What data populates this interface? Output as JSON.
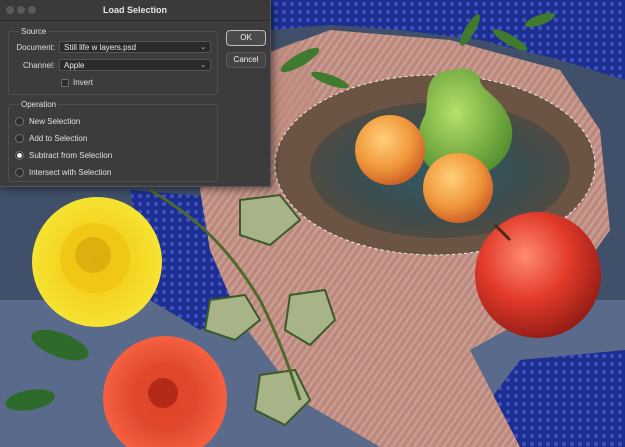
{
  "dialog": {
    "title": "Load Selection",
    "source": {
      "legend": "Source",
      "document_label": "Document:",
      "document_value": "Still life w layers.psd",
      "channel_label": "Channel:",
      "channel_value": "Apple",
      "invert_label": "Invert",
      "invert_checked": false
    },
    "operation": {
      "legend": "Operation",
      "options": [
        {
          "label": "New Selection",
          "selected": false
        },
        {
          "label": "Add to Selection",
          "selected": false
        },
        {
          "label": "Subtract from Selection",
          "selected": true
        },
        {
          "label": "Intersect with Selection",
          "selected": false
        }
      ]
    },
    "ok_label": "OK",
    "cancel_label": "Cancel"
  },
  "icons": [
    "chevron-down-icon",
    "radio-icon",
    "checkbox-icon"
  ]
}
